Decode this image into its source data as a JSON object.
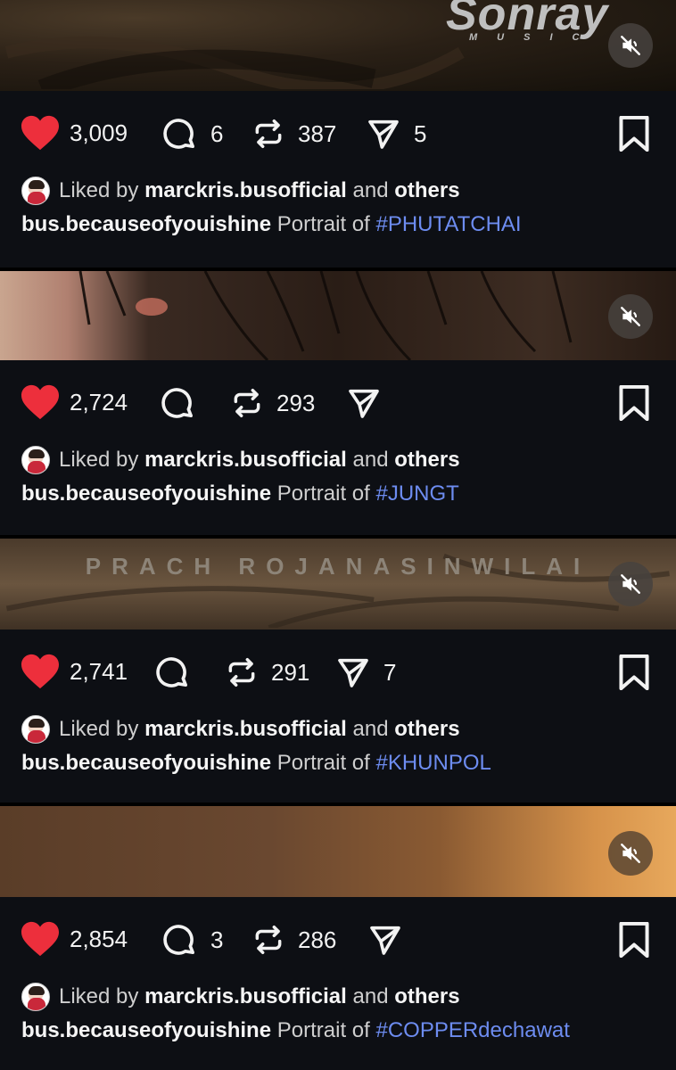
{
  "posts": [
    {
      "likes": "3,009",
      "comments": "6",
      "reposts": "387",
      "shares": "5",
      "liked_by_prefix": "Liked by",
      "liked_by_user": "marckris.busofficial",
      "liked_by_and": "and",
      "liked_by_others": "others",
      "author": "bus.becauseofyouishine",
      "caption_text": "Portrait of",
      "hashtag": "#PHUTATCHAI",
      "media_logo": "Sonray",
      "media_logo_sub": "MUSIC"
    },
    {
      "likes": "2,724",
      "comments": "",
      "reposts": "293",
      "shares": "",
      "liked_by_prefix": "Liked by",
      "liked_by_user": "marckris.busofficial",
      "liked_by_and": "and",
      "liked_by_others": "others",
      "author": "bus.becauseofyouishine",
      "caption_text": "Portrait of",
      "hashtag": "#JUNGT"
    },
    {
      "likes": "2,741",
      "comments": "",
      "reposts": "291",
      "shares": "7",
      "liked_by_prefix": "Liked by",
      "liked_by_user": "marckris.busofficial",
      "liked_by_and": "and",
      "liked_by_others": "others",
      "author": "bus.becauseofyouishine",
      "caption_text": "Portrait of",
      "hashtag": "#KHUNPOL",
      "media_overlay": "PRACH ROJANASINWILAI"
    },
    {
      "likes": "2,854",
      "comments": "3",
      "reposts": "286",
      "shares": "",
      "liked_by_prefix": "Liked by",
      "liked_by_user": "marckris.busofficial",
      "liked_by_and": "and",
      "liked_by_others": "others",
      "author": "bus.becauseofyouishine",
      "caption_text": "Portrait of",
      "hashtag": "#COPPERdechawat"
    }
  ],
  "colors": {
    "heart": "#ed2f3c",
    "hashtag": "#6d8cf0",
    "panel": "#0d0f14"
  },
  "icons": [
    "heart-icon",
    "comment-icon",
    "repost-icon",
    "share-icon",
    "bookmark-icon",
    "mute-icon"
  ]
}
